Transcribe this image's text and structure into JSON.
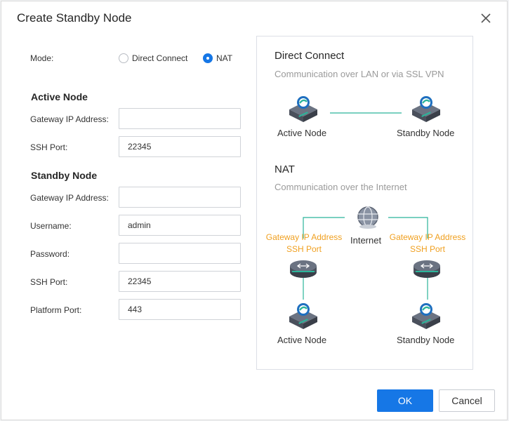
{
  "dialog": {
    "title": "Create Standby Node"
  },
  "mode": {
    "label": "Mode:",
    "options": [
      {
        "label": "Direct Connect",
        "selected": false
      },
      {
        "label": "NAT",
        "selected": true
      }
    ]
  },
  "active_node": {
    "heading": "Active Node",
    "gateway_ip_label": "Gateway IP Address:",
    "gateway_ip_value": "",
    "ssh_port_label": "SSH Port:",
    "ssh_port_value": "22345"
  },
  "standby_node": {
    "heading": "Standby Node",
    "gateway_ip_label": "Gateway IP Address:",
    "gateway_ip_value": "",
    "username_label": "Username:",
    "username_value": "admin",
    "password_label": "Password:",
    "password_value": "",
    "ssh_port_label": "SSH Port:",
    "ssh_port_value": "22345",
    "platform_port_label": "Platform Port:",
    "platform_port_value": "443"
  },
  "diagram": {
    "direct": {
      "title": "Direct Connect",
      "subtitle": "Communication over LAN or via SSL VPN",
      "active_label": "Active Node",
      "standby_label": "Standby Node"
    },
    "nat": {
      "title": "NAT",
      "subtitle": "Communication over the Internet",
      "internet_label": "Internet",
      "left_gateway": "Gateway IP Address",
      "left_ssh": "SSH Port",
      "right_gateway": "Gateway IP Address",
      "right_ssh": "SSH Port",
      "active_label": "Active Node",
      "standby_label": "Standby Node"
    },
    "colors": {
      "link": "#2bb59a",
      "annotation": "#f0a020",
      "node_top": "#5a6170",
      "node_side": "#3e4450"
    }
  },
  "footer": {
    "ok_label": "OK",
    "cancel_label": "Cancel"
  },
  "colors": {
    "primary": "#1677e6"
  }
}
